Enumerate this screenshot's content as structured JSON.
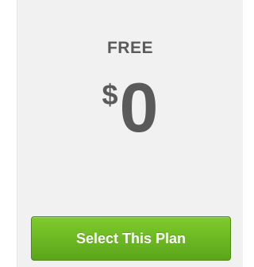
{
  "plan": {
    "name": "FREE",
    "currency": "$",
    "amount": "0",
    "button_label": "Select This Plan"
  },
  "colors": {
    "card_background": "#f1f1f1",
    "text": "#5a5a5a",
    "button_green": "#6bb823"
  }
}
